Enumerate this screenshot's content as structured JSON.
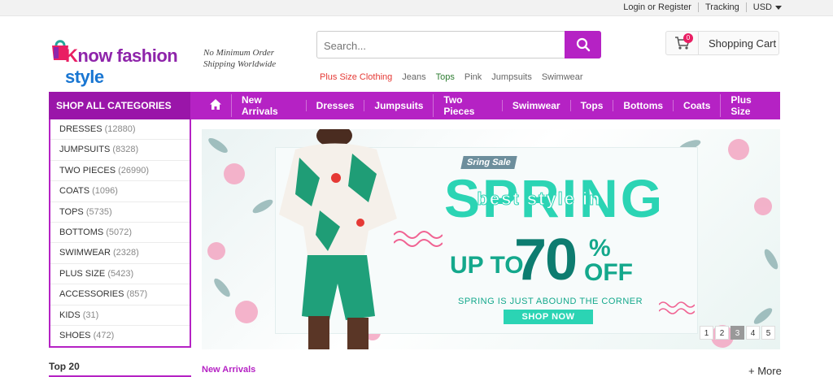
{
  "topbar": {
    "login": "Login or Register",
    "tracking": "Tracking",
    "currency": "USD"
  },
  "logo": {
    "k": "K",
    "now": "now ",
    "fashion": "fashion",
    "style": "style"
  },
  "tagline": {
    "line1": "No Minimum Order",
    "line2": "Shipping Worldwide"
  },
  "search": {
    "placeholder": "Search..."
  },
  "hotwords": [
    "Plus Size Clothing",
    "Jeans",
    "Tops",
    "Pink",
    "Jumpsuits",
    "Swimwear"
  ],
  "cart": {
    "label": "Shopping Cart",
    "count": "0"
  },
  "nav": {
    "categories_label": "SHOP ALL CATEGORIES",
    "items": [
      "New Arrivals",
      "Dresses",
      "Jumpsuits",
      "Two Pieces",
      "Swimwear",
      "Tops",
      "Bottoms",
      "Coats",
      "Plus Size"
    ]
  },
  "sidebar": [
    {
      "name": "DRESSES",
      "count": "(12880)"
    },
    {
      "name": "JUMPSUITS",
      "count": "(8328)"
    },
    {
      "name": "TWO PIECES",
      "count": "(26990)"
    },
    {
      "name": "COATS",
      "count": "(1096)"
    },
    {
      "name": "TOPS",
      "count": "(5735)"
    },
    {
      "name": "BOTTOMS",
      "count": "(5072)"
    },
    {
      "name": "SWIMWEAR",
      "count": "(2328)"
    },
    {
      "name": "PLUS SIZE",
      "count": "(5423)"
    },
    {
      "name": "ACCESSORIES",
      "count": "(857)"
    },
    {
      "name": "KIDS",
      "count": "(31)"
    },
    {
      "name": "SHOES",
      "count": "(472)"
    }
  ],
  "banner": {
    "tag": "Sring Sale",
    "spring": "SPRING",
    "best_style": "best style in",
    "up_to": "UP TO",
    "percent": "70",
    "pct_sign": "%",
    "off": "OFF",
    "corner": "SPRING IS JUST ABOUND THE CORNER",
    "shop_now": "SHOP NOW",
    "pages": [
      "1",
      "2",
      "3",
      "4",
      "5"
    ],
    "active_page": "3"
  },
  "top20": "Top 20",
  "section": {
    "title": "New Arrivals",
    "more": "+ More"
  },
  "colors": {
    "accent": "#b522c4",
    "teal": "#2bd4b4"
  },
  "icons": [
    "search-icon",
    "cart-icon",
    "home-icon",
    "caret-down-icon"
  ]
}
